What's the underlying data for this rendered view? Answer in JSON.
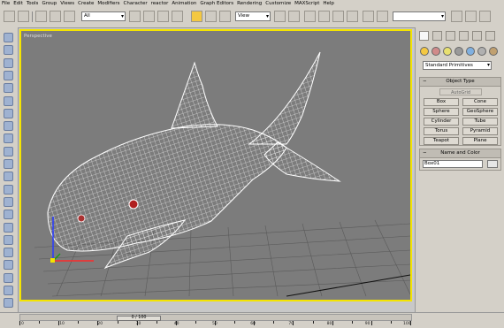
{
  "menu": [
    "File",
    "Edit",
    "Tools",
    "Group",
    "Views",
    "Create",
    "Modifiers",
    "Character",
    "reactor",
    "Animation",
    "Graph Editors",
    "Rendering",
    "Customize",
    "MAXScript",
    "Help"
  ],
  "toolbar": {
    "selection_filter": "All",
    "reference_coord": "View"
  },
  "viewport": {
    "label": "Perspective",
    "border_color": "#f4e400",
    "background_color": "#7c7c7c"
  },
  "command_panel": {
    "category_dropdown": "Standard Primitives",
    "object_type": {
      "title": "Object Type",
      "autogrid_label": "AutoGrid",
      "buttons": [
        "Box",
        "Cone",
        "Sphere",
        "GeoSphere",
        "Cylinder",
        "Tube",
        "Torus",
        "Pyramid",
        "Teapot",
        "Plane"
      ]
    },
    "name_and_color": {
      "title": "Name and Color",
      "name_value": "Box01"
    }
  },
  "timeline": {
    "slider_label": "0 / 100",
    "ruler_ticks": [
      "0",
      "10",
      "20",
      "30",
      "40",
      "50",
      "60",
      "70",
      "80",
      "90",
      "100"
    ]
  }
}
